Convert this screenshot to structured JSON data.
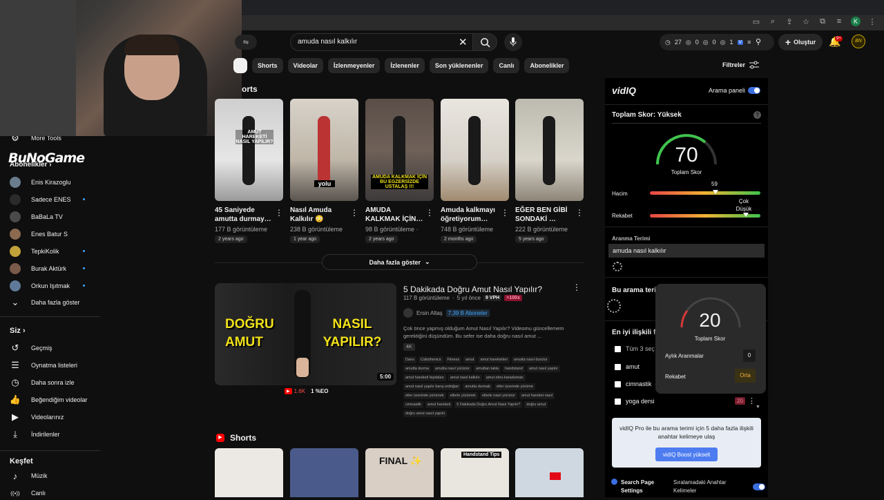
{
  "browser": {
    "profile_initial": "K"
  },
  "stream_overlay": {
    "logo_text": "BuNoGame"
  },
  "sidebar": {
    "more_tools": "More Tools",
    "subscriptions_header": "Abonelikler",
    "channels": [
      {
        "name": "Enis Kirazoglu",
        "dot": false,
        "color": "#6a7d8f"
      },
      {
        "name": "Sadece ENES",
        "dot": true,
        "color": "#2b2b2b"
      },
      {
        "name": "BaBaLa TV",
        "dot": false,
        "color": "#4a4a4a"
      },
      {
        "name": "Enes Batur S",
        "dot": false,
        "color": "#8b6a4f"
      },
      {
        "name": "TepkiKolik",
        "dot": true,
        "color": "#c2a13a"
      },
      {
        "name": "Burak Aktürk",
        "dot": true,
        "color": "#7a5a4a"
      },
      {
        "name": "Orkun Işıtmak",
        "dot": true,
        "color": "#5f7a99"
      }
    ],
    "show_more": "Daha fazla göster",
    "you_header": "Siz",
    "you_items": [
      {
        "label": "Geçmiş",
        "icon": "history-icon",
        "glyph": "↺"
      },
      {
        "label": "Oynatma listeleri",
        "icon": "playlist-icon",
        "glyph": "☰"
      },
      {
        "label": "Daha sonra izle",
        "icon": "clock-icon",
        "glyph": "◷"
      },
      {
        "label": "Beğendiğim videolar",
        "icon": "thumbs-up-icon",
        "glyph": "👍"
      },
      {
        "label": "Videolarınız",
        "icon": "video-icon",
        "glyph": "▶"
      },
      {
        "label": "İndirilenler",
        "icon": "download-icon",
        "glyph": "⤓"
      }
    ],
    "explore_header": "Keşfet",
    "explore_items": [
      {
        "label": "Müzik",
        "icon": "music-icon",
        "glyph": "♪"
      },
      {
        "label": "Canlı",
        "icon": "live-icon",
        "glyph": "((•))"
      }
    ]
  },
  "search": {
    "query": "amuda nasıl kalkılır"
  },
  "top_stats": {
    "a": "27",
    "b": "0",
    "c": "0",
    "d": "1"
  },
  "create_label": "Oluştur",
  "notif_count": "9+",
  "chips": [
    "Shorts",
    "Videolar",
    "İzlenmeyenler",
    "İzlenenler",
    "Son yüklenenler",
    "Canlı",
    "Abonelikler"
  ],
  "filters_label": "Filtreler",
  "shorts_header": "Shorts",
  "shorts": [
    {
      "title": "45 Saniyede amutta durmay…",
      "views": "177 B görüntüleme",
      "ago": "2 years ago",
      "overlay": "AMUT HAREKETİ NASIL YAPILIR?"
    },
    {
      "title": "Nasıl Amuda Kalkılır 😳",
      "views": "238 B görüntüleme",
      "ago": "1 year ago",
      "overlay": "yolu"
    },
    {
      "title": "AMUDA KALKMAK İÇİN…",
      "views": "98 B görüntüleme ·",
      "ago": "2 years ago",
      "overlay": "AMUDA KALKMAK İÇİN BU EGZERSİZDE USTALAŞ !!!"
    },
    {
      "title": "Amuda kalkmayı öğretiyorum…",
      "views": "748 B görüntüleme",
      "ago": "2 months ago",
      "overlay": ""
    },
    {
      "title": "EĞER BEN GİBİ SONDAKİ …",
      "views": "222 B görüntüleme",
      "ago": "5 years ago",
      "overlay": ""
    }
  ],
  "show_more_button": "Daha fazla göster",
  "video": {
    "title": "5 Dakikada Doğru Amut Nasıl Yapılır?",
    "views": "117 B görüntüleme",
    "ago": "5 yıl önce",
    "vph": "9 VPH",
    "multiplier": ">100x",
    "channel": "Ersin Altaş",
    "subscribers": "7,39 B Aboneler",
    "description": "Çok önce yapmış olduğum Amut Nasıl Yapılır? Videomu güncellemem gerektiğini düşündüm. Bu sefer ise daha doğru nasıl amut ...",
    "quality": "4K",
    "duration": "5:00",
    "thumb_left": "DOĞRU AMUT",
    "thumb_right": "NASIL YAPILIR?",
    "likes": "1.6K",
    "score": "1 %EO",
    "tags": [
      "Dans",
      "Calisthenics",
      "Fitness",
      "amut",
      "amut hareketleri",
      "amutta nasıl durulur",
      "amutta durma",
      "amutta nasıl yürünür",
      "amuttan takla",
      "handstand",
      "amut nasıl yapılır",
      "amut hareketi faydaları",
      "amut nasıl kalkılır",
      "amut ebru karaduman",
      "amut nasıl yapılır barış erdoğan",
      "amutta durmak",
      "eller üzerinde yürüme",
      "eller üzerinde yürümek",
      "ellerle yürümek",
      "ellerle nasıl yürünür",
      "amut hareket nasıl",
      "cimnastik",
      "amut hareketi",
      "5 Dakikada Doğru Amut Nasıl Yapılır?",
      "doğru amut",
      "doğru amut nasıl yapılır"
    ]
  },
  "shorts_header_2": "Shorts",
  "shorts2_overlays": [
    "",
    "",
    "FINAL ✨",
    "Handstand Tips",
    ""
  ],
  "vidiq": {
    "brand": "vidIQ",
    "panel_label": "Arama paneli",
    "total_score_title": "Toplam Skor: Yüksek",
    "score": "70",
    "score_label": "Toplam Skor",
    "volume_label": "Hacim",
    "volume_value": "59",
    "competition_label": "Rekabet",
    "competition_value": "Çok Düşük",
    "search_term_label": "Aranma Terimi",
    "search_term": "amuda nasıl kalkılır",
    "this_term_label": "Bu arama terim",
    "related_label": "En iyi ilişkili fı",
    "select_all": "Tüm 3 seç",
    "keywords": [
      "amut",
      "cimnastik",
      "yoga dersi"
    ],
    "keyword_badge": "20",
    "popup": {
      "score": "20",
      "score_label": "Toplam Skor",
      "monthly_label": "Aylık Aranmalar",
      "monthly_value": "0",
      "competition_label": "Rekabet",
      "competition_value": "Orta"
    },
    "boost_text": "vidIQ Pro ile bu arama terimi için 5 daha fazla ilişkili anahtar kelimeye ulaş",
    "boost_button": "vidIQ Boost yükselt",
    "footer_left": "Search Page Settings",
    "footer_right": "Sıralamadaki Anahtar Kelimeler"
  },
  "colors": {
    "accent_blue": "#3ea6ff",
    "vidiq_blue": "#4d7cf0",
    "red": "#ff0000"
  }
}
